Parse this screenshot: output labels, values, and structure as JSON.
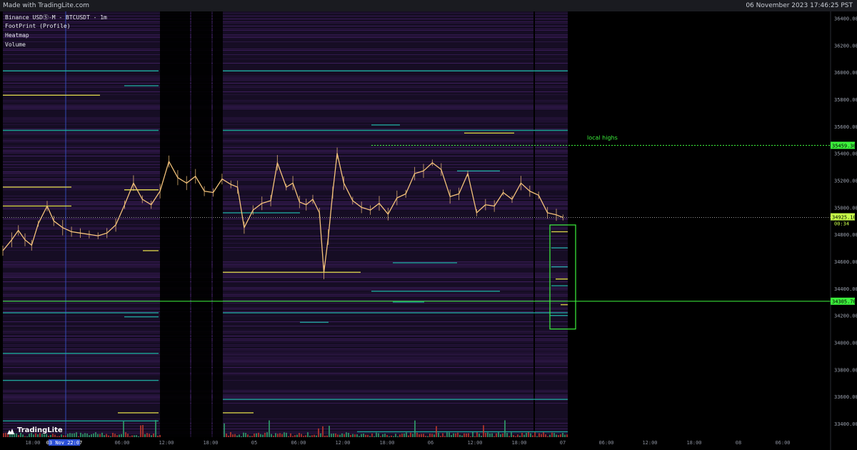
{
  "app": {
    "made_with": "Made with TradingLite.com",
    "timestamp": "06 November 2023 17:46:25 PST",
    "brand": "TradingLite"
  },
  "panel": {
    "symbol": "Binance USDⓈ-M - BTCUSDT - 1m",
    "indicators": [
      "FootPrint (Profile)",
      "Heatmap",
      "Volume"
    ]
  },
  "colors": {
    "heatmap_bg": "#160d24",
    "heatmap_purple": "#5a2a86",
    "heatmap_teal": "#1fb3a6",
    "heatmap_yellow": "#e8e24a",
    "candle": "#f4c27a",
    "annotation_green": "#3cf23c",
    "price_marker": "#c8ff4a"
  },
  "chart_data": {
    "type": "line",
    "title": "",
    "y_axis": {
      "ticks": [
        33400,
        33600,
        33800,
        34000,
        34200,
        34400,
        34600,
        34800,
        35000,
        35200,
        35400,
        35600,
        35800,
        36000,
        36200,
        36400
      ],
      "range": [
        33300,
        36450
      ]
    },
    "x_axis": {
      "tick_labels": [
        "18:00",
        "03 Nov 22:07",
        "06:00",
        "12:00",
        "18:00",
        "05",
        "06:00",
        "12:00",
        "18:00",
        "06",
        "12:00",
        "18:00",
        "07",
        "06:00",
        "12:00",
        "18:00",
        "08",
        "06:00"
      ]
    },
    "price_series": {
      "name": "BTCUSDT",
      "points": [
        [
          0,
          34680
        ],
        [
          4,
          34760
        ],
        [
          7,
          34830
        ],
        [
          10,
          34760
        ],
        [
          13,
          34720
        ],
        [
          16,
          34880
        ],
        [
          20,
          35010
        ],
        [
          23,
          34900
        ],
        [
          27,
          34850
        ],
        [
          31,
          34820
        ],
        [
          35,
          34810
        ],
        [
          39,
          34800
        ],
        [
          43,
          34790
        ],
        [
          47,
          34810
        ],
        [
          51,
          34870
        ],
        [
          55,
          35020
        ],
        [
          59,
          35180
        ],
        [
          63,
          35060
        ],
        [
          67,
          35020
        ],
        [
          71,
          35120
        ],
        [
          75,
          35340
        ],
        [
          79,
          35220
        ],
        [
          83,
          35180
        ],
        [
          87,
          35230
        ],
        [
          91,
          35120
        ],
        [
          95,
          35110
        ],
        [
          99,
          35210
        ],
        [
          103,
          35170
        ],
        [
          106,
          35150
        ],
        [
          109,
          34850
        ],
        [
          113,
          34980
        ],
        [
          117,
          35030
        ],
        [
          121,
          35050
        ],
        [
          124,
          35330
        ],
        [
          128,
          35150
        ],
        [
          131,
          35180
        ],
        [
          134,
          35040
        ],
        [
          137,
          35020
        ],
        [
          140,
          35060
        ],
        [
          143,
          34960
        ],
        [
          145,
          34520
        ],
        [
          147,
          34780
        ],
        [
          149,
          35110
        ],
        [
          151,
          35400
        ],
        [
          154,
          35180
        ],
        [
          158,
          35050
        ],
        [
          162,
          35000
        ],
        [
          166,
          34980
        ],
        [
          170,
          35030
        ],
        [
          174,
          34950
        ],
        [
          178,
          35070
        ],
        [
          182,
          35100
        ],
        [
          186,
          35250
        ],
        [
          190,
          35270
        ],
        [
          194,
          35330
        ],
        [
          198,
          35280
        ],
        [
          202,
          35080
        ],
        [
          206,
          35100
        ],
        [
          210,
          35250
        ],
        [
          214,
          34960
        ],
        [
          218,
          35020
        ],
        [
          222,
          35010
        ],
        [
          226,
          35110
        ],
        [
          230,
          35060
        ],
        [
          234,
          35180
        ],
        [
          238,
          35120
        ],
        [
          242,
          35090
        ],
        [
          246,
          34960
        ],
        [
          250,
          34945
        ],
        [
          253,
          34925
        ]
      ]
    },
    "annotations": [
      {
        "label": "local highs",
        "price": 35459.3,
        "marker": "35459.30"
      },
      {
        "label": "",
        "price": 34305.7,
        "marker": "34305.70"
      }
    ],
    "current_price": {
      "value": "34925.10",
      "countdown": "00:34"
    }
  }
}
